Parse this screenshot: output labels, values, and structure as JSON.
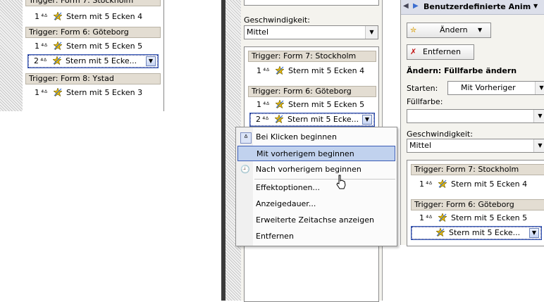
{
  "colors": {
    "trigger_bg": "#e3ddd2",
    "selection_border": "#3a5bb5",
    "menu_highlight": "#c1d2ee",
    "panel_title_bg": "#d4d8e8"
  },
  "left": {
    "top_cut_trigger": "Trigger: Form 7: Stockholm",
    "rows": [
      {
        "type": "effect",
        "num": "1",
        "label": "Stern mit 5 Ecken 4"
      },
      {
        "type": "trigger",
        "label": "Trigger: Form 6: Göteborg"
      },
      {
        "type": "effect",
        "num": "1",
        "label": "Stern mit 5 Ecken 5"
      },
      {
        "type": "effect",
        "num": "2",
        "label": "Stern mit 5 Ecke...",
        "selected": true
      },
      {
        "type": "trigger",
        "label": "Trigger: Form 8: Ystad"
      },
      {
        "type": "effect",
        "num": "1",
        "label": "Stern mit 5 Ecken 3"
      }
    ]
  },
  "middle": {
    "speed_label": "Geschwindigkeit:",
    "speed_value": "Mittel",
    "trigger1": "Trigger: Form 7: Stockholm",
    "t1_effect_num": "1",
    "t1_effect_label": "Stern mit 5 Ecken 4",
    "trigger2": "Trigger: Form 6: Göteborg",
    "t2_effect1_num": "1",
    "t2_effect1_label": "Stern mit 5 Ecken 5",
    "t2_effect2_num": "2",
    "t2_effect2_label": "Stern mit 5 Ecke...",
    "context_menu": [
      {
        "label": "Bei Klicken beginnen",
        "icon": "mouse-icon"
      },
      {
        "label": "Mit vorherigem beginnen",
        "highlighted": true
      },
      {
        "label": "Nach vorherigem beginnen",
        "icon": "clock-icon"
      },
      {
        "label": "Effektoptionen..."
      },
      {
        "label": "Anzeigedauer..."
      },
      {
        "label": "Erweiterte Zeitachse anzeigen"
      },
      {
        "label": "Entfernen"
      }
    ]
  },
  "right": {
    "panel_title": "Benutzerdefinierte Anim",
    "change_button": "Ändern",
    "remove_button": "Entfernen",
    "section_title": "Ändern: Füllfarbe ändern",
    "start_label": "Starten:",
    "start_value": "Mit Vorheriger",
    "fill_label": "Füllfarbe:",
    "speed_label": "Geschwindigkeit:",
    "speed_value": "Mittel",
    "trigger1": "Trigger: Form 7: Stockholm",
    "t1_effect_num": "1",
    "t1_effect_label": "Stern mit 5 Ecken 4",
    "trigger2": "Trigger: Form 6: Göteborg",
    "t2_effect1_num": "1",
    "t2_effect1_label": "Stern mit 5 Ecken 5",
    "t2_effect2_label": "Stern mit 5 Ecke..."
  }
}
